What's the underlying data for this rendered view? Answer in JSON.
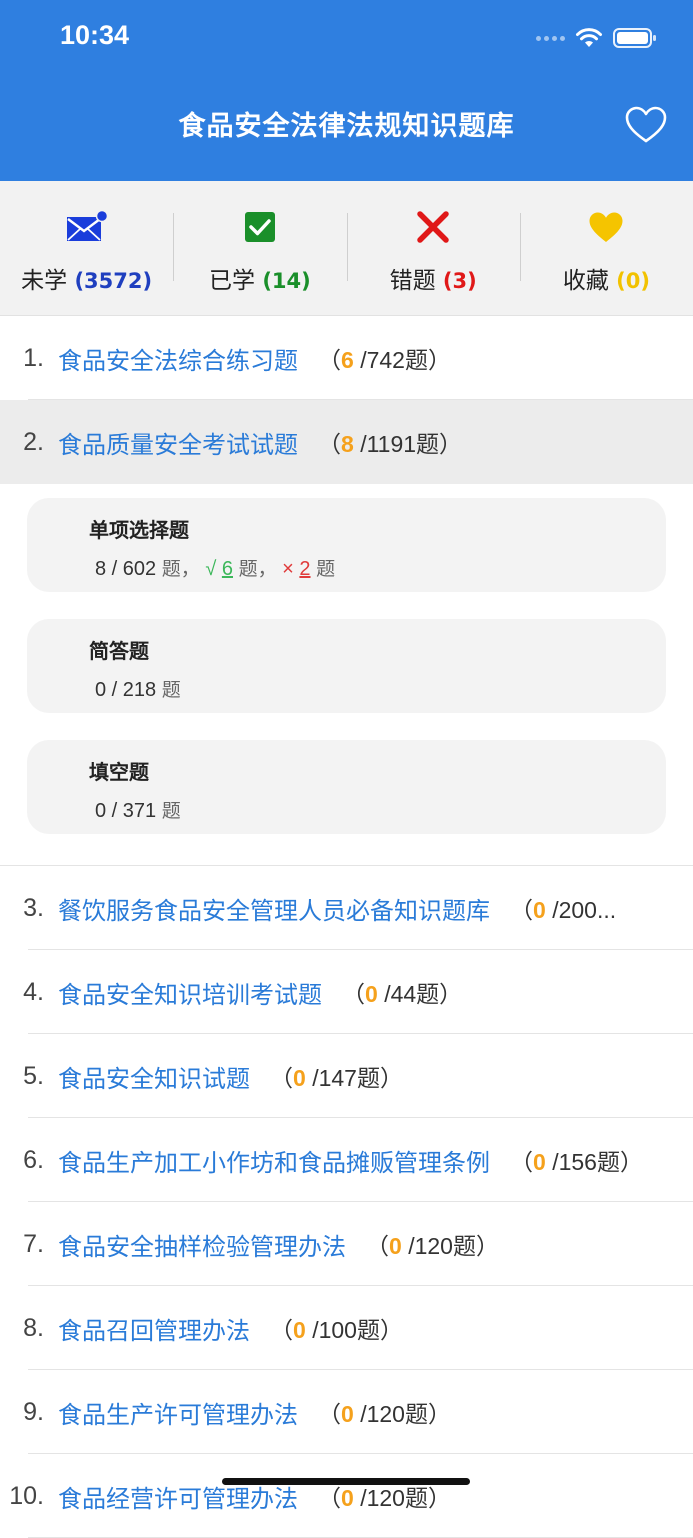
{
  "status_bar": {
    "time": "10:34"
  },
  "header": {
    "title": "食品安全法律法规知识题库"
  },
  "stats": [
    {
      "label": "未学",
      "count": "(3572)",
      "color_class": "c-blue",
      "icon": "mail-icon"
    },
    {
      "label": "已学",
      "count": "(14)",
      "color_class": "c-green",
      "icon": "check-icon"
    },
    {
      "label": "错题",
      "count": "(3)",
      "color_class": "c-red",
      "icon": "cross-icon"
    },
    {
      "label": "收藏",
      "count": "(0)",
      "color_class": "c-gold",
      "icon": "heart-icon"
    }
  ],
  "items": [
    {
      "num": "1.",
      "title": "食品安全法综合练习题",
      "done": "6",
      "total": "/742题）"
    },
    {
      "num": "2.",
      "title": "食品质量安全考试试题",
      "done": "8",
      "total": "/1191题）"
    },
    {
      "num": "3.",
      "title": "餐饮服务食品安全管理人员必备知识题库",
      "done": "0",
      "total": "/200..."
    },
    {
      "num": "4.",
      "title": "食品安全知识培训考试题",
      "done": "0",
      "total": "/44题）"
    },
    {
      "num": "5.",
      "title": "食品安全知识试题",
      "done": "0",
      "total": "/147题）"
    },
    {
      "num": "6.",
      "title": "食品生产加工小作坊和食品摊贩管理条例",
      "done": "0",
      "total": "/156题）"
    },
    {
      "num": "7.",
      "title": "食品安全抽样检验管理办法",
      "done": "0",
      "total": "/120题）"
    },
    {
      "num": "8.",
      "title": "食品召回管理办法",
      "done": "0",
      "total": "/100题）"
    },
    {
      "num": "9.",
      "title": "食品生产许可管理办法",
      "done": "0",
      "total": "/120题）"
    },
    {
      "num": "10.",
      "title": "食品经营许可管理办法",
      "done": "0",
      "total": "/120题）"
    }
  ],
  "meta_open": "（",
  "sub_sections": [
    {
      "title": "单项选择题",
      "progress": "8 / 602",
      "unit": "题",
      "sep": "，",
      "correct_mark": "√",
      "correct": "6",
      "wrong_mark": "×",
      "wrong": "2"
    },
    {
      "title": "简答题",
      "progress": "0 / 218",
      "unit": "题"
    },
    {
      "title": "填空题",
      "progress": "0 / 371",
      "unit": "题"
    }
  ],
  "colors": {
    "header_bg": "#2F7FE0",
    "link": "#2A7BD8",
    "done": "#F5A11C"
  }
}
